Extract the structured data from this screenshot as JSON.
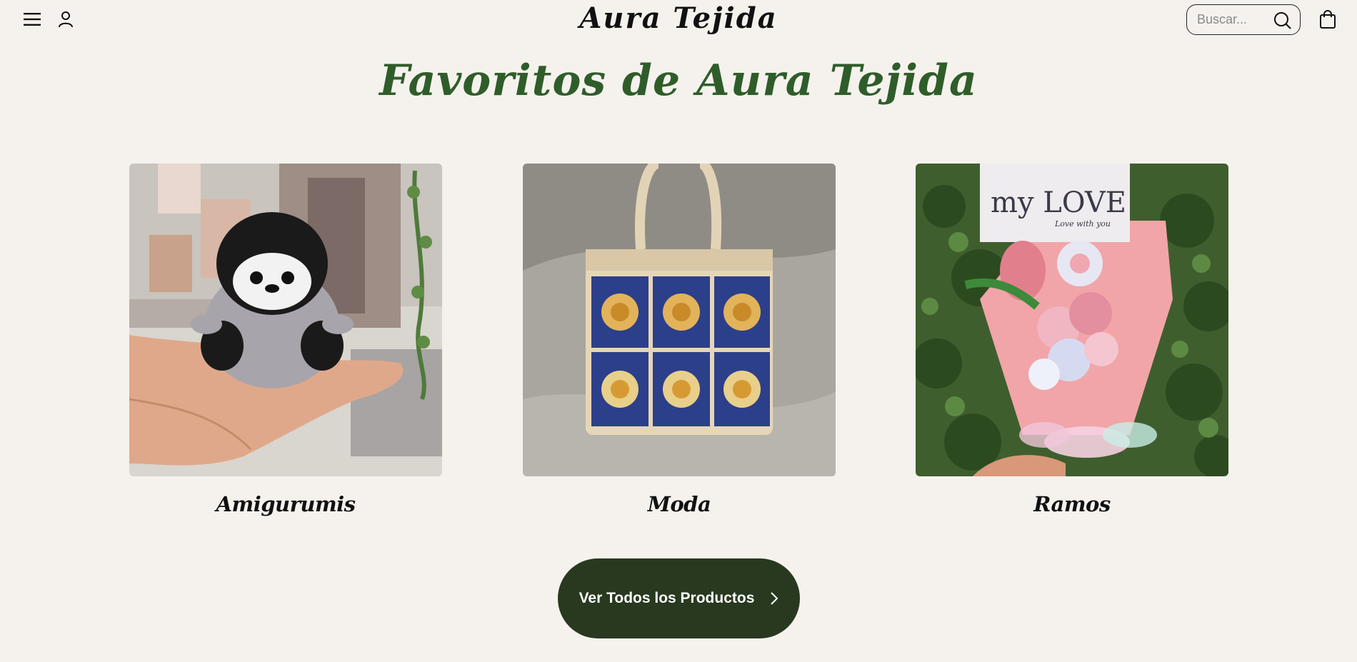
{
  "header": {
    "brand": "Aura Tejida",
    "search": {
      "placeholder": "Buscar...",
      "value": ""
    },
    "icons": [
      "menu-icon",
      "user-icon",
      "search-icon",
      "shopping-bag-icon"
    ]
  },
  "section": {
    "title": "Favoritos de Aura Tejida"
  },
  "categories": [
    {
      "label": "Amigurumis",
      "image": "crochet-penguin-photo"
    },
    {
      "label": "Moda",
      "image": "granny-square-bag-photo"
    },
    {
      "label": "Ramos",
      "image": "crochet-flower-bouquet-photo",
      "image_text": "my LOVE",
      "image_subtext": "Love with you"
    }
  ],
  "cta": {
    "label": "Ver Todos los Productos",
    "icon": "chevron-right-icon"
  },
  "colors": {
    "background": "#f5f2ed",
    "title_green": "#2f5d2a",
    "cta_background": "#28391f",
    "text": "#111111"
  }
}
